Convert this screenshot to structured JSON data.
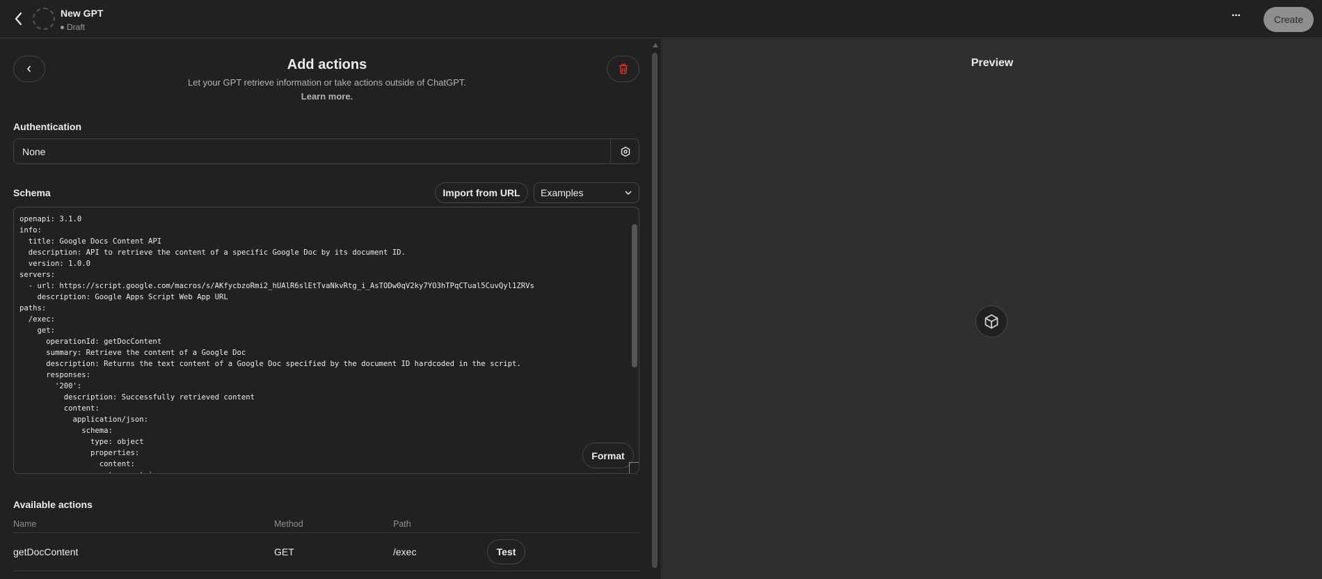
{
  "header": {
    "title": "New GPT",
    "status": "Draft",
    "create_label": "Create",
    "more_label": "···"
  },
  "editor": {
    "title": "Add actions",
    "subtitle": "Let your GPT retrieve information or take actions outside of ChatGPT.",
    "learn_more": "Learn more.",
    "auth_label": "Authentication",
    "auth_value": "None",
    "schema_label": "Schema",
    "import_label": "Import from URL",
    "examples_label": "Examples",
    "format_label": "Format",
    "schema_text": "openapi: 3.1.0\ninfo:\n  title: Google Docs Content API\n  description: API to retrieve the content of a specific Google Doc by its document ID.\n  version: 1.0.0\nservers:\n  - url: https://script.google.com/macros/s/AKfycbzoRmi2_hUAlR6slEtTvaNkvRtg_i_AsTODw0qV2ky7YO3hTPqCTual5CuvQyl1ZRVs\n    description: Google Apps Script Web App URL\npaths:\n  /exec:\n    get:\n      operationId: getDocContent\n      summary: Retrieve the content of a Google Doc\n      description: Returns the text content of a Google Doc specified by the document ID hardcoded in the script.\n      responses:\n        '200':\n          description: Successfully retrieved content\n          content:\n            application/json:\n              schema:\n                type: object\n                properties:\n                  content:\n                    type: string",
    "actions_label": "Available actions",
    "columns": [
      "Name",
      "Method",
      "Path"
    ],
    "actions": [
      {
        "name": "getDocContent",
        "method": "GET",
        "path": "/exec",
        "test_label": "Test"
      }
    ]
  },
  "preview": {
    "title": "Preview"
  },
  "colors": {
    "danger": "#e02e2a",
    "bg": "#212121",
    "preview_bg": "#2f2f2f"
  }
}
